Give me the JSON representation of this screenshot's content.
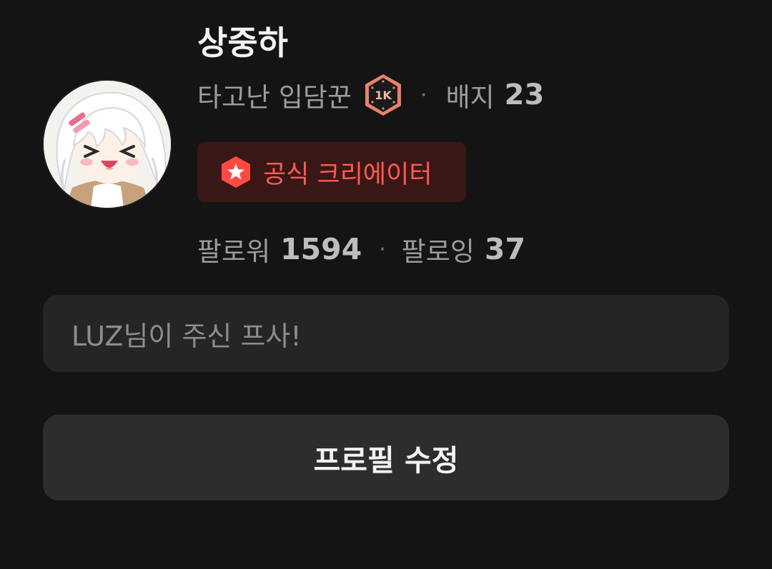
{
  "profile": {
    "name": "상중하",
    "title": "타고난 입담꾼",
    "rank_badge": "1K",
    "badge_label": "배지",
    "badge_count": "23",
    "creator_label": "공식 크리에이터",
    "followers_label": "팔로워",
    "followers_count": "1594",
    "following_label": "팔로잉",
    "following_count": "37",
    "bio": "LUZ님이 주신 프사!",
    "separator": "·"
  },
  "actions": {
    "edit_profile_label": "프로필 수정"
  },
  "colors": {
    "background": "#141414",
    "accent_red": "#ff5b52",
    "chip_bg": "#3a1717",
    "badge_orange": "#e8836a"
  },
  "icons": {
    "rank_badge": "hexagon-1k-icon",
    "creator": "hexagon-star-icon"
  }
}
